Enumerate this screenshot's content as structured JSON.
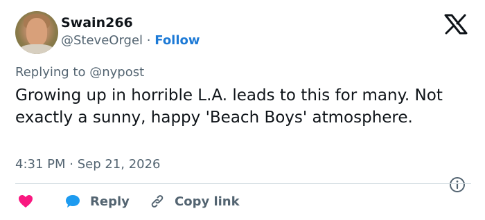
{
  "author": {
    "display_name": "Swain266",
    "handle": "@SteveOrgel",
    "separator": "·",
    "follow_label": "Follow"
  },
  "reply_context": {
    "prefix": "Replying to",
    "mention": "@nypost"
  },
  "tweet": {
    "text": "Growing up in horrible L.A. leads to this for many. Not exactly a sunny, happy 'Beach Boys' atmosphere."
  },
  "meta": {
    "timestamp": "4:31 PM · Sep 21, 2026"
  },
  "actions": {
    "reply_label": "Reply",
    "copy_link_label": "Copy link"
  },
  "colors": {
    "heart": "#f91880",
    "reply": "#1d9bf0",
    "follow": "#1d7ad6",
    "muted": "#536471",
    "text": "#0f1419"
  },
  "icons": [
    "x-logo-icon",
    "info-icon",
    "heart-icon",
    "reply-bubble-icon",
    "link-icon"
  ]
}
